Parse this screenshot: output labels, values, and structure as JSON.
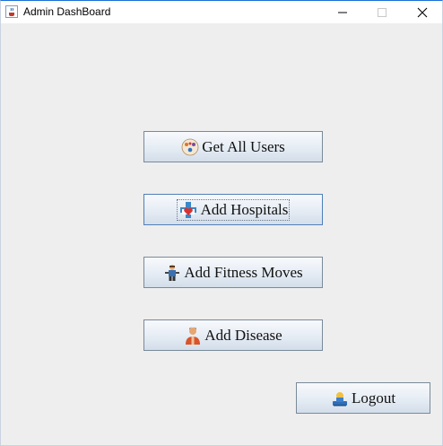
{
  "window": {
    "title": "Admin DashBoard",
    "icon": "java-cup-icon"
  },
  "buttons": {
    "get_all_users": {
      "label": "Get All Users",
      "icon": "users-icon"
    },
    "add_hospitals": {
      "label": "Add Hospitals",
      "icon": "hospital-heart-icon"
    },
    "add_fitness_moves": {
      "label": "Add Fitness Moves",
      "icon": "fitness-person-icon"
    },
    "add_disease": {
      "label": "Add Disease",
      "icon": "patient-icon"
    },
    "logout": {
      "label": "Logout",
      "icon": "logout-user-icon"
    }
  }
}
